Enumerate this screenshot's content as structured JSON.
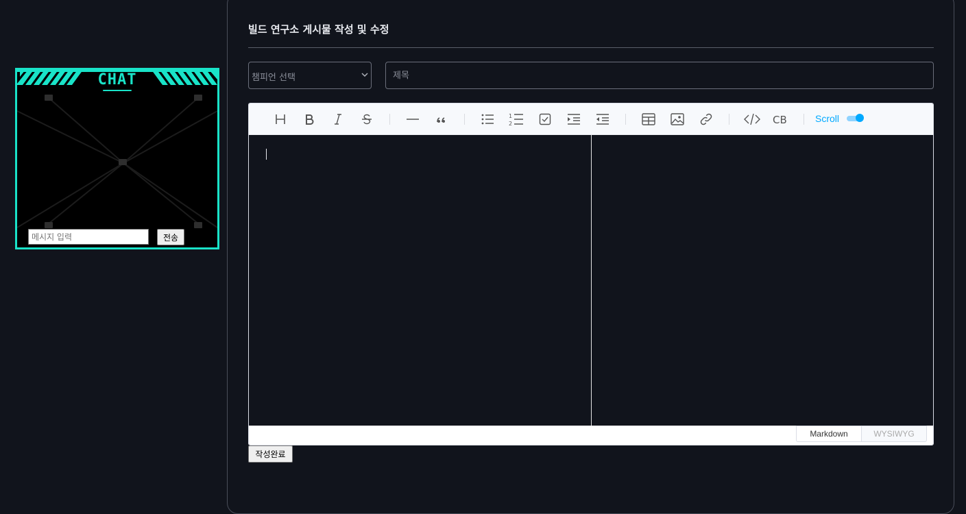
{
  "chat": {
    "title": "CHAT",
    "input_placeholder": "메시지 입력",
    "send_label": "전송",
    "accent_color": "#19e3c8"
  },
  "form": {
    "page_title": "빌드 연구소 게시물 작성 및 수정",
    "champion_select_placeholder": "챔피언 선택",
    "title_placeholder": "제목",
    "submit_label": "작성완료"
  },
  "editor": {
    "toolbar": [
      {
        "icon": "heading-icon"
      },
      {
        "icon": "bold-icon"
      },
      {
        "icon": "italic-icon"
      },
      {
        "icon": "strike-icon"
      },
      {
        "icon": "hr-icon"
      },
      {
        "icon": "quote-icon"
      },
      {
        "icon": "bullet-list-icon"
      },
      {
        "icon": "ordered-list-icon"
      },
      {
        "icon": "task-list-icon"
      },
      {
        "icon": "indent-icon"
      },
      {
        "icon": "outdent-icon"
      },
      {
        "icon": "table-icon"
      },
      {
        "icon": "image-icon"
      },
      {
        "icon": "link-icon"
      },
      {
        "icon": "code-icon"
      },
      {
        "icon": "codeblock-icon"
      }
    ],
    "codeblock_label": "CB",
    "scroll_label": "Scroll",
    "scroll_sync_on": true,
    "modes": {
      "markdown": "Markdown",
      "wysiwyg": "WYSIWYG"
    },
    "active_mode": "markdown",
    "accent_color": "#00a9ff"
  }
}
